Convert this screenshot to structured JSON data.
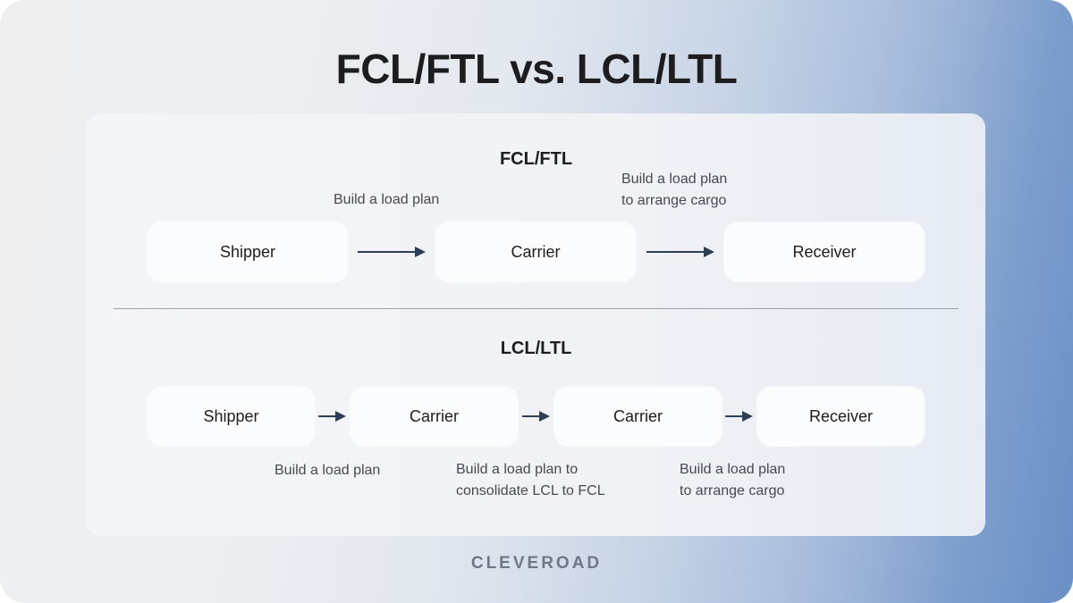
{
  "title": "FCL/FTL vs. LCL/LTL",
  "fcl": {
    "heading": "FCL/FTL",
    "nodes": [
      "Shipper",
      "Carrier",
      "Receiver"
    ],
    "labels": [
      "Build a load plan",
      "Build a load plan\nto arrange cargo"
    ]
  },
  "lcl": {
    "heading": "LCL/LTL",
    "nodes": [
      "Shipper",
      "Carrier",
      "Carrier",
      "Receiver"
    ],
    "labels": [
      "Build a load plan",
      "Build a load plan to\nconsolidate LCL to FCL",
      "Build a load plan\nto arrange cargo"
    ]
  },
  "brand": "CLEVEROAD",
  "colors": {
    "arrow": "#2d3e55",
    "text": "#1d1d1f",
    "accent_blue": "#6a8fc6"
  }
}
